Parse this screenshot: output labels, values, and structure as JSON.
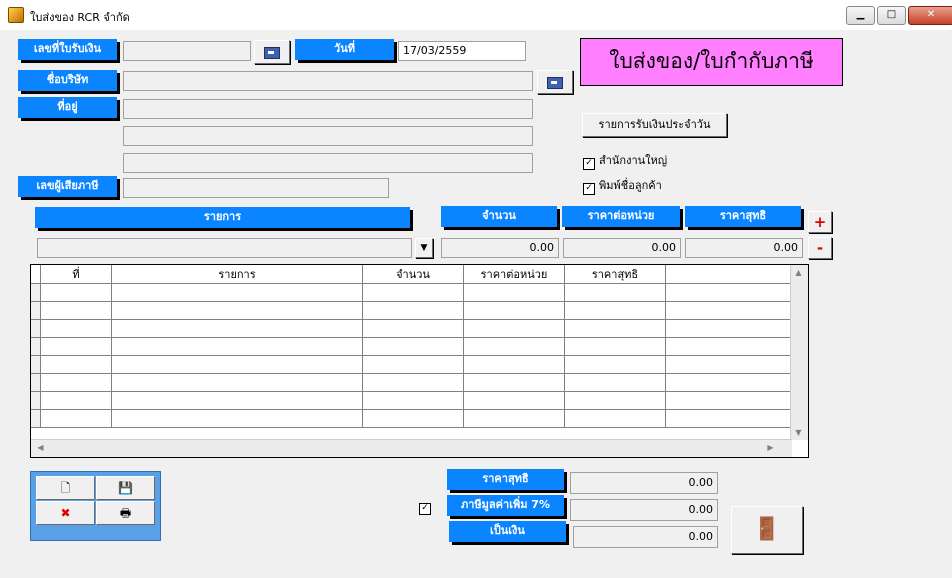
{
  "window": {
    "title": "ใบส่งของ RCR จำกัด",
    "min": "▁",
    "max": "□",
    "close": "✕"
  },
  "labels": {
    "receipt_no": "เลขที่ใบรับเงิน",
    "date": "วันที่",
    "company": "ชื่อบริษัท",
    "address": "ที่อยู่",
    "tax_id": "เลขผู้เสียภาษี",
    "item": "รายการ",
    "qty": "จำนวน",
    "unit_price": "ราคาต่อหน่วย",
    "net_price": "ราคาสุทธิ",
    "total_net": "ราคาสุทธิ",
    "vat": "ภาษีมูลค่าเพิ่ม 7%",
    "grand_total": "เป็นเงิน"
  },
  "fields": {
    "receipt_no": "",
    "date": "17/03/2559",
    "company": "",
    "address1": "",
    "address2": "",
    "address3": "",
    "tax_id": "",
    "item_select": "",
    "qty": "0.00",
    "unit_price": "0.00",
    "net_price": "0.00",
    "total_net": "0.00",
    "vat": "0.00",
    "grand_total": "0.00"
  },
  "doc_title": "ใบส่งของ/ใบกำกับภาษี",
  "daily_button": "รายการรับเงินประจำวัน",
  "checkboxes": [
    {
      "label": "สำนักงานใหญ่",
      "checked": true
    },
    {
      "label": "พิมพ์ชื่อลูกค้า",
      "checked": true
    }
  ],
  "vat_checkbox_checked": true,
  "grid": {
    "columns": [
      "ที่",
      "รายการ",
      "จำนวน",
      "ราคาต่อหน่วย",
      "ราคาสุทธิ",
      ""
    ],
    "row_count": 8
  },
  "buttons": {
    "plus": "+",
    "minus": "-"
  },
  "icons": {
    "find_receipt": "search-book-icon",
    "find_company": "search-book-icon",
    "new": "new-document-icon",
    "save": "floppy-disk-icon",
    "delete": "delete-record-icon",
    "print": "printer-icon",
    "exit": "exit-door-icon"
  }
}
